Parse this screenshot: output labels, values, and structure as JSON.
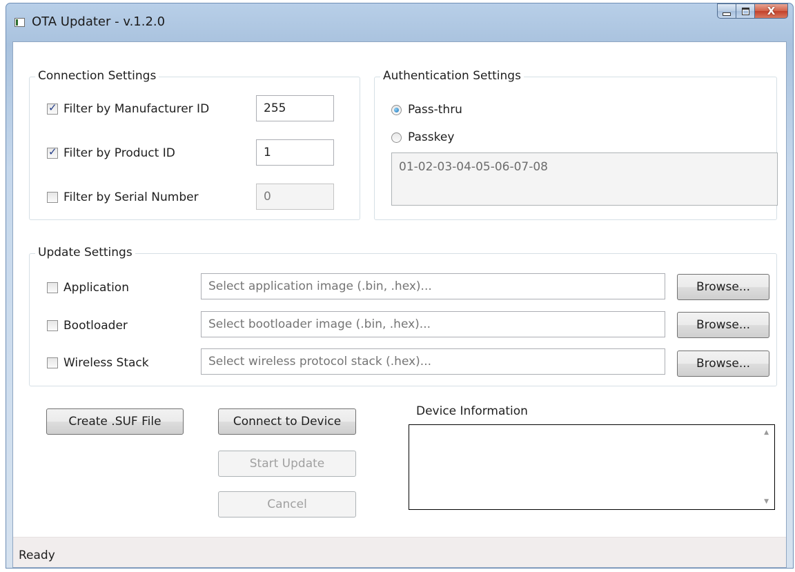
{
  "window": {
    "title": "OTA Updater - v.1.2.0",
    "close_glyph": "X"
  },
  "connection": {
    "title": "Connection Settings",
    "manufacturer": {
      "label": "Filter by Manufacturer ID",
      "checked": true,
      "value": "255"
    },
    "product": {
      "label": "Filter by Product ID",
      "checked": true,
      "value": "1"
    },
    "serial": {
      "label": "Filter by Serial Number",
      "checked": false,
      "value": "0"
    }
  },
  "auth": {
    "title": "Authentication Settings",
    "passthru_label": "Pass-thru",
    "passkey_label": "Passkey",
    "selected": "Pass-thru",
    "passkey_value": "01-02-03-04-05-06-07-08"
  },
  "update": {
    "title": "Update Settings",
    "application": {
      "label": "Application",
      "checked": false,
      "placeholder": "Select application image (.bin, .hex)..."
    },
    "bootloader": {
      "label": "Bootloader",
      "checked": false,
      "placeholder": "Select bootloader image (.bin, .hex)..."
    },
    "wireless": {
      "label": "Wireless Stack",
      "checked": false,
      "placeholder": "Select wireless protocol stack (.hex)..."
    },
    "browse_label": "Browse..."
  },
  "actions": {
    "create_suf": "Create .SUF File",
    "connect": "Connect to Device",
    "start_update": "Start Update",
    "cancel": "Cancel"
  },
  "device_info": {
    "label": "Device Information"
  },
  "status": {
    "text": "Ready"
  }
}
